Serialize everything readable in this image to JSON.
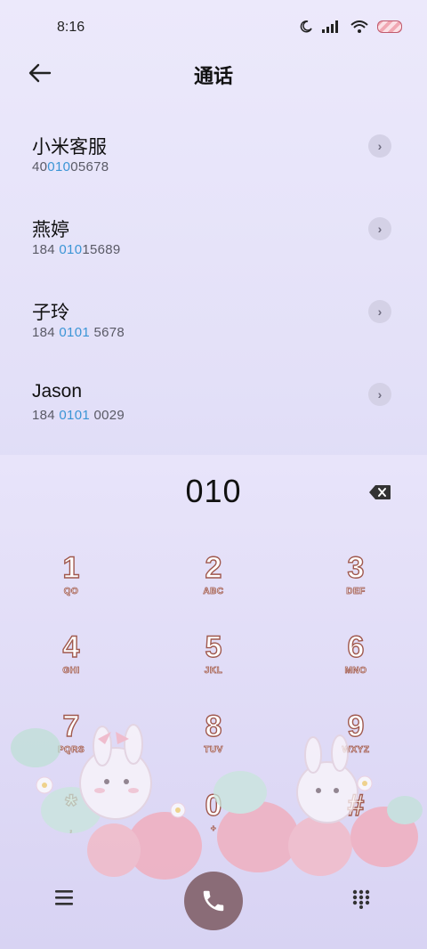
{
  "status": {
    "time": "8:16"
  },
  "header": {
    "title": "通话"
  },
  "contacts": [
    {
      "name": "小米客服",
      "num_pre": "40",
      "num_hl": "010",
      "num_post": "05678"
    },
    {
      "name": "燕婷",
      "num_pre": "184 ",
      "num_hl": "010",
      "num_post": "15689"
    },
    {
      "name": "子玲",
      "num_pre": "184 ",
      "num_hl": "0101",
      "num_post": " 5678"
    },
    {
      "name": "Jason",
      "num_pre": "184 ",
      "num_hl": "0101",
      "num_post": " 0029"
    }
  ],
  "dialer": {
    "entered": "010"
  },
  "keys": [
    {
      "digit": "1",
      "letters": "QO"
    },
    {
      "digit": "2",
      "letters": "ABC"
    },
    {
      "digit": "3",
      "letters": "DEF"
    },
    {
      "digit": "4",
      "letters": "GHI"
    },
    {
      "digit": "5",
      "letters": "JKL"
    },
    {
      "digit": "6",
      "letters": "MNO"
    },
    {
      "digit": "7",
      "letters": "PQRS"
    },
    {
      "digit": "8",
      "letters": "TUV"
    },
    {
      "digit": "9",
      "letters": "WXYZ"
    },
    {
      "digit": "*",
      "letters": ","
    },
    {
      "digit": "0",
      "letters": "+"
    },
    {
      "digit": "#",
      "letters": ""
    }
  ],
  "colors": {
    "accent_blue": "#3b95d6",
    "call_button": "#8a6c77",
    "key_outline": "#a0594e"
  }
}
